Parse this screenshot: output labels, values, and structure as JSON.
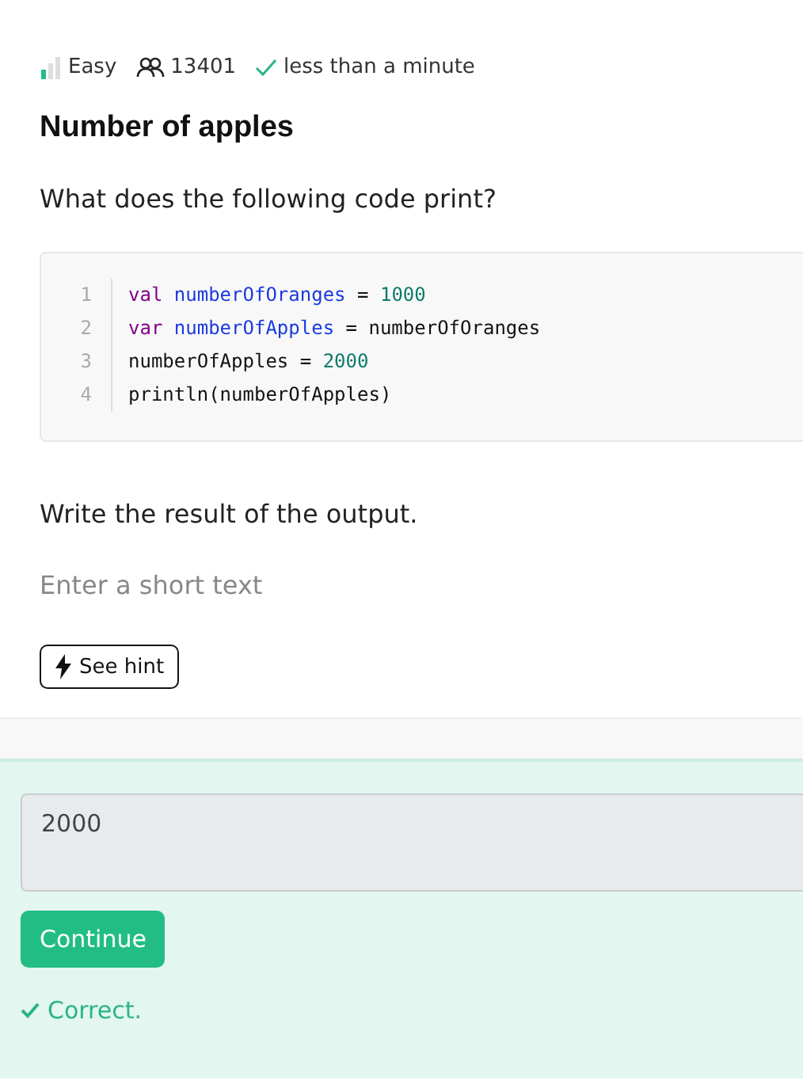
{
  "meta": {
    "difficulty": "Easy",
    "solved_count": "13401",
    "time": "less than a minute"
  },
  "title": "Number of apples",
  "question": "What does the following code print?",
  "code": [
    {
      "number": "1",
      "tokens": [
        {
          "kind": "keyword",
          "text": "val "
        },
        {
          "kind": "ident",
          "text": "numberOfOranges"
        },
        {
          "kind": "plain",
          "text": " = "
        },
        {
          "kind": "number",
          "text": "1000"
        }
      ]
    },
    {
      "number": "2",
      "tokens": [
        {
          "kind": "keyword",
          "text": "var "
        },
        {
          "kind": "ident",
          "text": "numberOfApples"
        },
        {
          "kind": "plain",
          "text": " = numberOfOranges"
        }
      ]
    },
    {
      "number": "3",
      "tokens": [
        {
          "kind": "plain",
          "text": "numberOfApples = "
        },
        {
          "kind": "number",
          "text": "2000"
        }
      ]
    },
    {
      "number": "4",
      "tokens": [
        {
          "kind": "plain",
          "text": "println(numberOfApples)"
        }
      ]
    }
  ],
  "instruction": "Write the result of the output.",
  "short_answer": {
    "placeholder": "Enter a short text"
  },
  "hint_button": "See hint",
  "answer": {
    "value": "2000"
  },
  "continue_button": "Continue",
  "feedback": "Correct."
}
